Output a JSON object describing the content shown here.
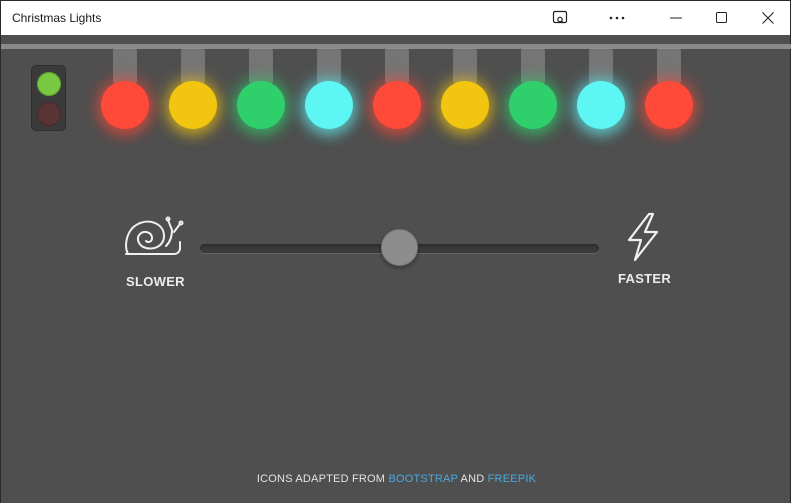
{
  "window": {
    "title": "Christmas Lights",
    "controls": [
      "cast-icon",
      "more-icon",
      "minimize-icon",
      "maximize-icon",
      "close-icon"
    ]
  },
  "toggle": {
    "on_color": "#7ac943",
    "off_color": "#5a3434"
  },
  "lights": [
    {
      "color": "#ff4a3a"
    },
    {
      "color": "#f2c511"
    },
    {
      "color": "#2fcf6c"
    },
    {
      "color": "#5ef5f5"
    },
    {
      "color": "#ff4a3a"
    },
    {
      "color": "#f2c511"
    },
    {
      "color": "#2fcf6c"
    },
    {
      "color": "#5ef5f5"
    },
    {
      "color": "#ff4a3a"
    }
  ],
  "speed": {
    "slow_label": "SLOWER",
    "fast_label": "FASTER",
    "slow_icon": "snail-icon",
    "fast_icon": "lightning-icon",
    "value": 0.5
  },
  "credits": {
    "prefix": "ICONS ADAPTED FROM",
    "link1": "BOOTSTRAP",
    "and": "AND",
    "link2": "FREEPIK",
    "link_color": "#4aa8e0"
  }
}
